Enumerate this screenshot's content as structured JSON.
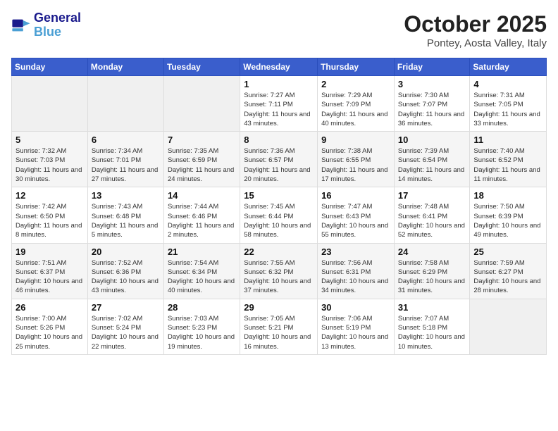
{
  "header": {
    "logo_line1": "General",
    "logo_line2": "Blue",
    "month": "October 2025",
    "location": "Pontey, Aosta Valley, Italy"
  },
  "days_of_week": [
    "Sunday",
    "Monday",
    "Tuesday",
    "Wednesday",
    "Thursday",
    "Friday",
    "Saturday"
  ],
  "weeks": [
    [
      {
        "num": "",
        "info": ""
      },
      {
        "num": "",
        "info": ""
      },
      {
        "num": "",
        "info": ""
      },
      {
        "num": "1",
        "info": "Sunrise: 7:27 AM\nSunset: 7:11 PM\nDaylight: 11 hours and 43 minutes."
      },
      {
        "num": "2",
        "info": "Sunrise: 7:29 AM\nSunset: 7:09 PM\nDaylight: 11 hours and 40 minutes."
      },
      {
        "num": "3",
        "info": "Sunrise: 7:30 AM\nSunset: 7:07 PM\nDaylight: 11 hours and 36 minutes."
      },
      {
        "num": "4",
        "info": "Sunrise: 7:31 AM\nSunset: 7:05 PM\nDaylight: 11 hours and 33 minutes."
      }
    ],
    [
      {
        "num": "5",
        "info": "Sunrise: 7:32 AM\nSunset: 7:03 PM\nDaylight: 11 hours and 30 minutes."
      },
      {
        "num": "6",
        "info": "Sunrise: 7:34 AM\nSunset: 7:01 PM\nDaylight: 11 hours and 27 minutes."
      },
      {
        "num": "7",
        "info": "Sunrise: 7:35 AM\nSunset: 6:59 PM\nDaylight: 11 hours and 24 minutes."
      },
      {
        "num": "8",
        "info": "Sunrise: 7:36 AM\nSunset: 6:57 PM\nDaylight: 11 hours and 20 minutes."
      },
      {
        "num": "9",
        "info": "Sunrise: 7:38 AM\nSunset: 6:55 PM\nDaylight: 11 hours and 17 minutes."
      },
      {
        "num": "10",
        "info": "Sunrise: 7:39 AM\nSunset: 6:54 PM\nDaylight: 11 hours and 14 minutes."
      },
      {
        "num": "11",
        "info": "Sunrise: 7:40 AM\nSunset: 6:52 PM\nDaylight: 11 hours and 11 minutes."
      }
    ],
    [
      {
        "num": "12",
        "info": "Sunrise: 7:42 AM\nSunset: 6:50 PM\nDaylight: 11 hours and 8 minutes."
      },
      {
        "num": "13",
        "info": "Sunrise: 7:43 AM\nSunset: 6:48 PM\nDaylight: 11 hours and 5 minutes."
      },
      {
        "num": "14",
        "info": "Sunrise: 7:44 AM\nSunset: 6:46 PM\nDaylight: 11 hours and 2 minutes."
      },
      {
        "num": "15",
        "info": "Sunrise: 7:45 AM\nSunset: 6:44 PM\nDaylight: 10 hours and 58 minutes."
      },
      {
        "num": "16",
        "info": "Sunrise: 7:47 AM\nSunset: 6:43 PM\nDaylight: 10 hours and 55 minutes."
      },
      {
        "num": "17",
        "info": "Sunrise: 7:48 AM\nSunset: 6:41 PM\nDaylight: 10 hours and 52 minutes."
      },
      {
        "num": "18",
        "info": "Sunrise: 7:50 AM\nSunset: 6:39 PM\nDaylight: 10 hours and 49 minutes."
      }
    ],
    [
      {
        "num": "19",
        "info": "Sunrise: 7:51 AM\nSunset: 6:37 PM\nDaylight: 10 hours and 46 minutes."
      },
      {
        "num": "20",
        "info": "Sunrise: 7:52 AM\nSunset: 6:36 PM\nDaylight: 10 hours and 43 minutes."
      },
      {
        "num": "21",
        "info": "Sunrise: 7:54 AM\nSunset: 6:34 PM\nDaylight: 10 hours and 40 minutes."
      },
      {
        "num": "22",
        "info": "Sunrise: 7:55 AM\nSunset: 6:32 PM\nDaylight: 10 hours and 37 minutes."
      },
      {
        "num": "23",
        "info": "Sunrise: 7:56 AM\nSunset: 6:31 PM\nDaylight: 10 hours and 34 minutes."
      },
      {
        "num": "24",
        "info": "Sunrise: 7:58 AM\nSunset: 6:29 PM\nDaylight: 10 hours and 31 minutes."
      },
      {
        "num": "25",
        "info": "Sunrise: 7:59 AM\nSunset: 6:27 PM\nDaylight: 10 hours and 28 minutes."
      }
    ],
    [
      {
        "num": "26",
        "info": "Sunrise: 7:00 AM\nSunset: 5:26 PM\nDaylight: 10 hours and 25 minutes."
      },
      {
        "num": "27",
        "info": "Sunrise: 7:02 AM\nSunset: 5:24 PM\nDaylight: 10 hours and 22 minutes."
      },
      {
        "num": "28",
        "info": "Sunrise: 7:03 AM\nSunset: 5:23 PM\nDaylight: 10 hours and 19 minutes."
      },
      {
        "num": "29",
        "info": "Sunrise: 7:05 AM\nSunset: 5:21 PM\nDaylight: 10 hours and 16 minutes."
      },
      {
        "num": "30",
        "info": "Sunrise: 7:06 AM\nSunset: 5:19 PM\nDaylight: 10 hours and 13 minutes."
      },
      {
        "num": "31",
        "info": "Sunrise: 7:07 AM\nSunset: 5:18 PM\nDaylight: 10 hours and 10 minutes."
      },
      {
        "num": "",
        "info": ""
      }
    ]
  ]
}
